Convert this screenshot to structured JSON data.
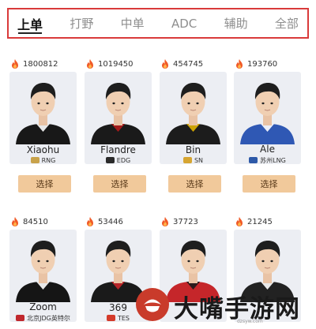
{
  "tabs": [
    {
      "label": "上单",
      "active": true
    },
    {
      "label": "打野",
      "active": false
    },
    {
      "label": "中单",
      "active": false
    },
    {
      "label": "ADC",
      "active": false
    },
    {
      "label": "辅助",
      "active": false
    },
    {
      "label": "全部",
      "active": false
    }
  ],
  "select_label": "选择",
  "players": [
    {
      "heat": "1800812",
      "name": "Xiaohu",
      "team": "RNG",
      "team_color": "#c8a24a",
      "jersey": "#181818",
      "accent": "#ffffff"
    },
    {
      "heat": "1019450",
      "name": "Flandre",
      "team": "EDG",
      "team_color": "#2a2a2a",
      "jersey": "#1a1a1a",
      "accent": "#b31c1c"
    },
    {
      "heat": "454745",
      "name": "Bin",
      "team": "SN",
      "team_color": "#d6a531",
      "jersey": "#1c1c1c",
      "accent": "#e0b200"
    },
    {
      "heat": "193760",
      "name": "Ale",
      "team": "苏州LNG",
      "team_color": "#2d59a8",
      "jersey": "#2f58b4",
      "accent": "#ffffff"
    },
    {
      "heat": "84510",
      "name": "Zoom",
      "team": "北京JDG英特尔",
      "team_color": "#c0272d",
      "jersey": "#151515",
      "accent": "#ffffff"
    },
    {
      "heat": "53446",
      "name": "369",
      "team": "TES",
      "team_color": "#d43a2a",
      "jersey": "#1a1a1a",
      "accent": "#c8262a"
    },
    {
      "heat": "37723",
      "name": "",
      "team": "",
      "team_color": "#c0272d",
      "jersey": "#c5262a",
      "accent": "#1a1a1a"
    },
    {
      "heat": "21245",
      "name": "",
      "team": "",
      "team_color": "#777777",
      "jersey": "#222222",
      "accent": "#ffffff"
    }
  ],
  "watermark": {
    "text": "大嘴手游网",
    "url": "dzsyw.com"
  }
}
